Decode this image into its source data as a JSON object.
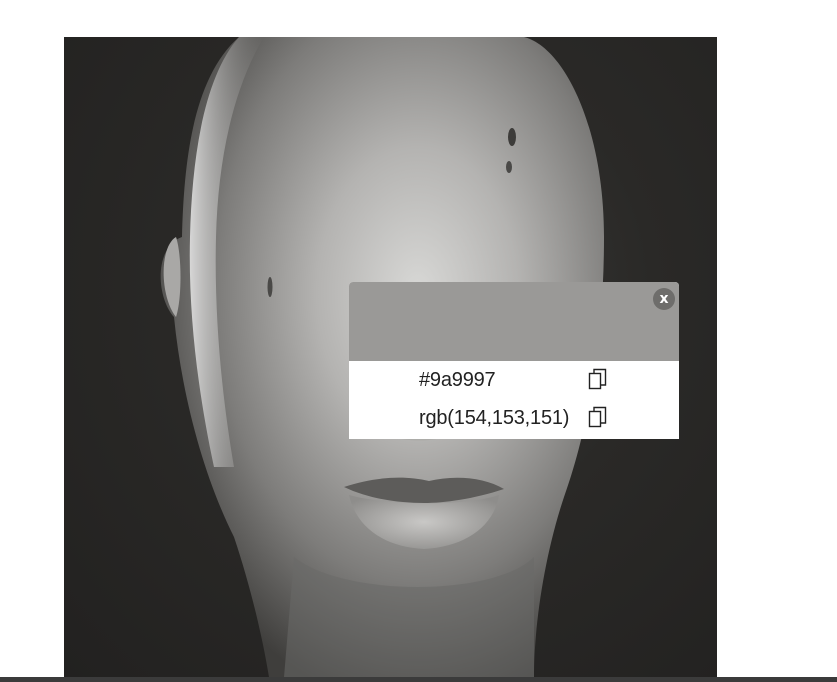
{
  "picker": {
    "swatch_color": "#9a9997",
    "close_label": "x",
    "hex_value": "#9a9997",
    "rgb_value": "rgb(154,153,151)"
  },
  "icons": {
    "close": "close-icon",
    "copy_hex": "copy-icon",
    "copy_rgb": "copy-icon"
  }
}
